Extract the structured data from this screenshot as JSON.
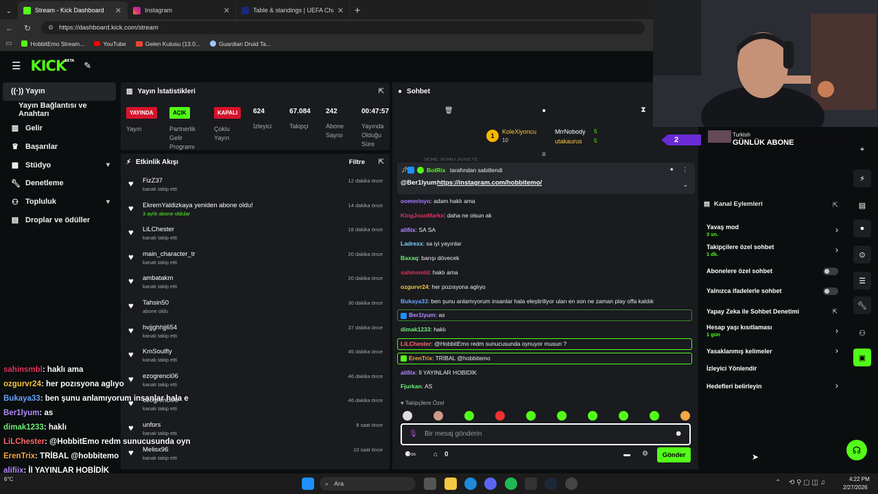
{
  "browser": {
    "tabs": [
      {
        "title": "Stream - Kick Dashboard",
        "active": true
      },
      {
        "title": "Instagram",
        "active": false
      },
      {
        "title": "Table & standings | UEFA Champio",
        "active": false
      }
    ],
    "url": "https://dashboard.kick.com/stream",
    "bookmarks": [
      "HobbitEmo Stream...",
      "YouTube",
      "Gelen Kutusu (13.0...",
      "Guardian Druid Ta..."
    ]
  },
  "brand": {
    "logo": "KICK",
    "beta": "BETA",
    "accent": "#53fc18"
  },
  "sidebar": {
    "items": [
      {
        "label": "Yayın",
        "icon": "broadcast-icon"
      },
      {
        "label": "Yayın Bağlantısı ve Anahtarı",
        "icon": ""
      },
      {
        "label": "Gelir",
        "icon": "chart-icon"
      },
      {
        "label": "Başarılar",
        "icon": "trophy-icon"
      },
      {
        "label": "Stüdyo",
        "icon": "studio-icon"
      },
      {
        "label": "Denetleme",
        "icon": "wrench-icon"
      },
      {
        "label": "Topluluk",
        "icon": "community-icon"
      },
      {
        "label": "Droplar ve ödüller",
        "icon": "gift-icon"
      }
    ]
  },
  "stats": {
    "title": "Yayın İstatistikleri",
    "yayin_badge": "YAYINDA",
    "yayin_label": "Yayın",
    "partner_badge": "AÇIK",
    "partner_label_1": "Partnerlik",
    "partner_label_2": "Gelir",
    "partner_label_3": "Programı",
    "multi_badge": "KAPALI",
    "multi_label_1": "Çoklu",
    "multi_label_2": "Yayın",
    "viewers_value": "624",
    "viewers_label": "İzleyici",
    "followers_value": "67.084",
    "followers_label": "Takipçi",
    "subs_value": "242",
    "subs_label_1": "Abone",
    "subs_label_2": "Sayısı",
    "uptime_value": "00:47:57",
    "uptime_label_1": "Yayında",
    "uptime_label_2": "Olduğu",
    "uptime_label_3": "Süre"
  },
  "activity": {
    "title": "Etkinlik Akışı",
    "filter": "Filtre",
    "items": [
      {
        "name": "FizZ37",
        "sub": "kanalı takip etti",
        "time": "12 dakika önce"
      },
      {
        "name": "EkremYaldizkaya yeniden abone oldu!",
        "sub": "3 aylık abone oldular",
        "time": "14 dakika önce"
      },
      {
        "name": "LiLChester",
        "sub": "kanalı takip etti",
        "time": "18 dakika önce"
      },
      {
        "name": "main_character_tr",
        "sub": "kanalı takip etti",
        "time": "20 dakika önce"
      },
      {
        "name": "ambatakm",
        "sub": "kanalı takip etti",
        "time": "20 dakika önce"
      },
      {
        "name": "Tahsin50",
        "sub": "abone oldu",
        "time": "30 dakika önce"
      },
      {
        "name": "hvjjghhjj654",
        "sub": "kanalı takip etti",
        "time": "37 dakika önce"
      },
      {
        "name": "KmSoulfly",
        "sub": "kanalı takip etti",
        "time": "45 dakika önce"
      },
      {
        "name": "ezogrenci06",
        "sub": "kanalı takip etti",
        "time": "46 dakika önce"
      },
      {
        "name": "ezogrenci06",
        "sub": "kanalı takip etti",
        "time": "46 dakika önce"
      },
      {
        "name": "unfors",
        "sub": "kanalı takip etti",
        "time": "8 saat önce"
      },
      {
        "name": "Melisx96",
        "sub": "kanalı takip etti",
        "time": "10 saat önce"
      }
    ]
  },
  "chat": {
    "title": "Sohbet",
    "leaders": [
      {
        "name": "KoleXiyoncu",
        "value": "10",
        "rank": "1"
      },
      {
        "name": "MrrNobody",
        "value": "5"
      },
      {
        "name": "utakaurus",
        "value": "5"
      }
    ],
    "pinned_by": "BotRix",
    "pinned_suffix": "tarafından sabitlendi",
    "pinned_user": "@Ber1lyum",
    "pinned_link": "https://instagram.com/hobbitemo/",
    "cut_top": "SENE SONU JUVETE",
    "messages": [
      {
        "user": "oomerinyo",
        "text": ": adam haklı ama",
        "color": "#a97cff"
      },
      {
        "user": "KingJoaoMarkx",
        "text": ": daha ne olsun ak",
        "color": "#e0325e"
      },
      {
        "user": "alifiix",
        "text": ": SA SA",
        "color": "#b48cff"
      },
      {
        "user": "Ladrexx",
        "text": ": sa iyi yayınlar",
        "color": "#7bd3ff"
      },
      {
        "user": "Baxaq",
        "text": ": barışı dövecek",
        "color": "#6cf07a"
      },
      {
        "user": "sahinsmbl",
        "text": ": haklı ama",
        "color": "#e0325e"
      },
      {
        "user": "ozgurvr24",
        "text": ": her pozısyona aglıyo",
        "color": "#f5c842"
      },
      {
        "user": "Bukaya33",
        "text": ": ben şunu anlamıyorum insanlar hala eleştiriliyor ulan en son ne zaman play offa kaldık",
        "color": "#6aa6ff"
      },
      {
        "user": "Ber1lyum",
        "text": ": as",
        "color": "#b48cff"
      },
      {
        "user": "dimak1233",
        "text": ": haklı",
        "color": "#6cf07a"
      },
      {
        "user": "LiLChester",
        "text": ": @HobbitEmo redm sunucusunda oynuyor musun ?",
        "color": "#ff6a6a"
      },
      {
        "user": "ErenTrix",
        "text": ": TRİBAL @hobbitemo",
        "color": "#f5a742"
      },
      {
        "user": "alifiix",
        "text": ": İl YAYINLAR HOBİDİK",
        "color": "#b48cff"
      },
      {
        "user": "Fjurkan",
        "text": ": AS",
        "color": "#6cf07a"
      }
    ],
    "followers_only": "Takipçilere Özel",
    "input_placeholder": "Bir mesaj gönderin",
    "points": "0",
    "send_label": "Gönder"
  },
  "overlay": {
    "left_value": "2",
    "language": "Turkish",
    "goal_label": "GÜNLÜK ABONE",
    "right_value": "10"
  },
  "channel_actions": {
    "title": "Kanal Eylemleri",
    "slow_mode": "Yavaş mod",
    "slow_mode_value": "3 sn.",
    "followers_chat": "Takipçilere özel sohbet",
    "followers_chat_value": "1 dk.",
    "subs_chat": "Abonelere özel sohbet",
    "emote_chat": "Yalnızca ifadelerle sohbet",
    "ai_mod": "Yapay Zeka ile Sohbet Denetimi",
    "age_restrict": "Hesap yaşı kısıtlaması",
    "age_restrict_value": "1 gün",
    "banned_words": "Yasaklanmış kelimeler",
    "raid": "İzleyici Yönlendir",
    "goals": "Hedefleri belirleyin"
  },
  "overlay_chat": [
    {
      "user": "sahinsmbl",
      "text": ": haklı ama",
      "color": "#e0325e"
    },
    {
      "user": "ozgurvr24",
      "text": ": her pozısyona aglıyo",
      "color": "#f5c842"
    },
    {
      "user": "Bukaya33",
      "text": ": ben şunu anlamıyorum insanlar hala e",
      "color": "#6aa6ff"
    },
    {
      "user": "Ber1lyum",
      "text": ": as",
      "color": "#b48cff"
    },
    {
      "user": "dimak1233",
      "text": ": haklı",
      "color": "#6cf07a"
    },
    {
      "user": "LiLChester",
      "text": ": @HobbitEmo redm sunucusunda oyn",
      "color": "#ff6a6a"
    },
    {
      "user": "ErenTrix",
      "text": ": TRİBAL @hobbitemo",
      "color": "#f5a742"
    },
    {
      "user": "alifiix",
      "text": ": İl YAYINLAR HOBİDİK",
      "color": "#b48cff"
    },
    {
      "user": "Fjurkan",
      "text": ": AS",
      "color": "#6cf07a"
    }
  ],
  "taskbar": {
    "search": "Ara",
    "weather": "6°C",
    "time": "4:22 PM",
    "date": "2/27/2026"
  }
}
